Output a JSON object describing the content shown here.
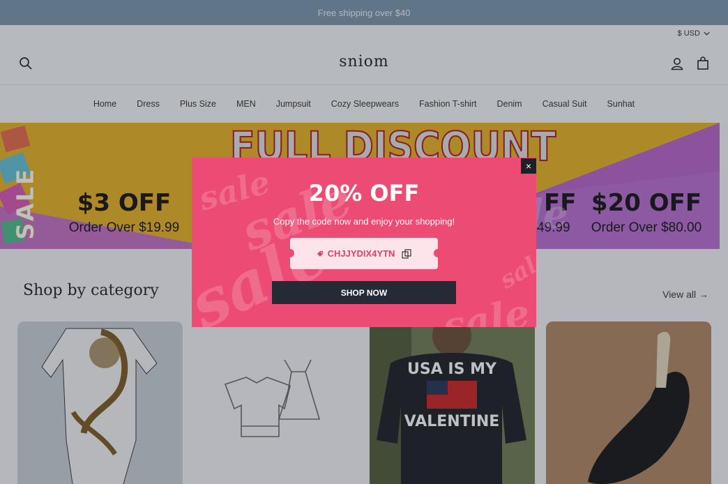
{
  "announcement": "Free shipping over $40",
  "header": {
    "currency": "$ USD",
    "logo": "sniom"
  },
  "nav": [
    "Home",
    "Dress",
    "Plus Size",
    "MEN",
    "Jumpsuit",
    "Cozy Sleepwears",
    "Fashion T-shirt",
    "Denim",
    "Casual Suit",
    "Sunhat"
  ],
  "banner": {
    "headline": "FULL DISCOUNT",
    "sale_word": "SALE",
    "offers": [
      {
        "amount": "$3 OFF",
        "condition": "Order Over $19.99"
      },
      {
        "amount": "FF",
        "condition": "49.99"
      },
      {
        "amount": "$20 OFF",
        "condition": "Order Over $80.00"
      }
    ],
    "watermark": "sale"
  },
  "category": {
    "title": "Shop by category",
    "view_all": "View all →",
    "card_texts": [
      "USA IS MY",
      "VALENTINE"
    ]
  },
  "popup": {
    "title": "20% OFF",
    "subtitle": "Copy the code now and enjoy your shopping!",
    "code": "CHJJYDIX4YTN",
    "button": "SHOP NOW",
    "close": "×",
    "watermark": "sale"
  },
  "colors": {
    "announcement_bg": "#7a94ad",
    "popup_bg": "#ec4c73",
    "button_bg": "#262a36"
  }
}
